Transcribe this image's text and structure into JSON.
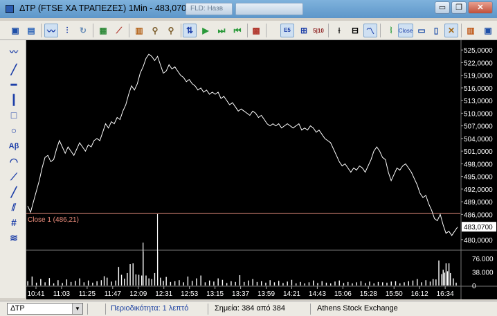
{
  "window": {
    "title": "ΔΤΡ (FTSE ΧΑ ΤΡΑΠΕΖΕΣ) 1Min - 483,0700",
    "field1": "FLD: Назв",
    "field2": "",
    "controls": {
      "minimize": "▭",
      "restore": "❐",
      "close": "✕"
    }
  },
  "toolbar": {
    "icons": [
      "save-icon",
      "properties-icon",
      "line-chart-icon",
      "bar-chart-icon",
      "refresh-icon",
      "grid-chart-icon",
      "indicators-icon",
      "bars-icon",
      "zoom-in-icon",
      "zoom-out-icon",
      "cursor-sync-icon",
      "play-icon",
      "step-forward-icon",
      "step-back-icon",
      "calculator-icon",
      "fibonacci-icon",
      "scale-icon",
      "ohlc-icon",
      "candlestick-icon",
      "line-icon",
      "pattern-icon",
      "close-price-icon",
      "window-icon",
      "layout-icon",
      "tools-icon",
      "export-icon",
      "chart-type-icon"
    ],
    "close_label": "Close",
    "fib_label": "E\n5",
    "scale_label": "5\n10"
  },
  "left_toolbar": {
    "text_tool_label": "Aβ"
  },
  "statusbar": {
    "symbol": "ΔΤΡ",
    "periodicity": "Περιοδικότητα: 1 λεπτό",
    "points": "Σημεία: 384 από 384",
    "exchange": "Athens Stock Exchange"
  },
  "colors": {
    "background": "#000000",
    "price_line": "#ffffff",
    "volume": "#ffffff",
    "reference_line": "#e08a7a",
    "reference_label": "#f08f7e",
    "axis_text": "#ffffff"
  },
  "chart_data": {
    "type": "line",
    "title": "ΔΤΡ (FTSE ΧΑ ΤΡΑΠΕΖΕΣ) 1Min",
    "reference_label": "Close 1 (486,21)",
    "reference_value": 486.21,
    "current_value_label": "483,0700",
    "current_value": 483.07,
    "price_ylim": [
      478.0,
      527.0
    ],
    "price_ticks": [
      "525,0000",
      "522,0000",
      "519,0000",
      "516,0000",
      "513,0000",
      "510,0000",
      "507,0000",
      "504,0000",
      "501,0000",
      "498,0000",
      "495,0000",
      "492,0000",
      "489,0000",
      "486,0000",
      "480,0000"
    ],
    "volume_ticks": [
      "76.000",
      "38.000",
      "0"
    ],
    "volume_ylim": [
      0,
      95000
    ],
    "x_ticks": [
      "10:41",
      "11:03",
      "11:25",
      "11:47",
      "12:09",
      "12:31",
      "12:53",
      "13:15",
      "13:37",
      "13:59",
      "14:21",
      "14:43",
      "15:06",
      "15:28",
      "15:50",
      "16:12",
      "16:34"
    ],
    "price_points": [
      [
        0,
        488.0
      ],
      [
        2,
        486.5
      ],
      [
        4,
        489.0
      ],
      [
        6,
        491.5
      ],
      [
        8,
        494.0
      ],
      [
        10,
        497.0
      ],
      [
        12,
        499.5
      ],
      [
        14,
        500.0
      ],
      [
        16,
        498.5
      ],
      [
        18,
        499.0
      ],
      [
        20,
        501.5
      ],
      [
        22,
        503.5
      ],
      [
        24,
        502.0
      ],
      [
        26,
        500.5
      ],
      [
        28,
        502.0
      ],
      [
        30,
        501.0
      ],
      [
        32,
        500.0
      ],
      [
        34,
        501.5
      ],
      [
        36,
        503.0
      ],
      [
        38,
        502.0
      ],
      [
        40,
        501.0
      ],
      [
        42,
        502.5
      ],
      [
        44,
        502.0
      ],
      [
        46,
        503.5
      ],
      [
        48,
        504.0
      ],
      [
        50,
        503.5
      ],
      [
        52,
        505.5
      ],
      [
        54,
        507.5
      ],
      [
        56,
        506.5
      ],
      [
        58,
        508.0
      ],
      [
        60,
        507.5
      ],
      [
        62,
        509.0
      ],
      [
        64,
        508.5
      ],
      [
        66,
        510.5
      ],
      [
        68,
        512.0
      ],
      [
        70,
        514.5
      ],
      [
        72,
        516.5
      ],
      [
        74,
        515.5
      ],
      [
        76,
        517.0
      ],
      [
        78,
        519.5
      ],
      [
        80,
        521.0
      ],
      [
        82,
        523.0
      ],
      [
        84,
        524.0
      ],
      [
        86,
        523.5
      ],
      [
        88,
        522.5
      ],
      [
        90,
        523.5
      ],
      [
        92,
        521.5
      ],
      [
        94,
        519.5
      ],
      [
        96,
        520.0
      ],
      [
        98,
        521.5
      ],
      [
        100,
        520.5
      ],
      [
        102,
        521.0
      ],
      [
        104,
        520.0
      ],
      [
        106,
        519.0
      ],
      [
        108,
        518.5
      ],
      [
        110,
        517.5
      ],
      [
        112,
        518.0
      ],
      [
        114,
        517.0
      ],
      [
        116,
        516.5
      ],
      [
        118,
        515.5
      ],
      [
        120,
        516.0
      ],
      [
        122,
        515.0
      ],
      [
        124,
        515.5
      ],
      [
        126,
        514.5
      ],
      [
        128,
        515.0
      ],
      [
        130,
        514.5
      ],
      [
        132,
        515.0
      ],
      [
        134,
        513.5
      ],
      [
        136,
        514.0
      ],
      [
        138,
        513.0
      ],
      [
        140,
        512.0
      ],
      [
        142,
        512.5
      ],
      [
        144,
        511.5
      ],
      [
        146,
        510.5
      ],
      [
        148,
        511.0
      ],
      [
        150,
        510.5
      ],
      [
        152,
        510.0
      ],
      [
        154,
        509.5
      ],
      [
        156,
        510.5
      ],
      [
        158,
        510.0
      ],
      [
        160,
        509.0
      ],
      [
        162,
        509.5
      ],
      [
        164,
        508.5
      ],
      [
        166,
        507.5
      ],
      [
        168,
        507.0
      ],
      [
        170,
        507.5
      ],
      [
        172,
        507.0
      ],
      [
        174,
        507.5
      ],
      [
        176,
        506.5
      ],
      [
        178,
        507.0
      ],
      [
        180,
        507.5
      ],
      [
        182,
        507.0
      ],
      [
        184,
        506.5
      ],
      [
        186,
        507.0
      ],
      [
        188,
        507.5
      ],
      [
        190,
        506.0
      ],
      [
        192,
        506.5
      ],
      [
        194,
        506.0
      ],
      [
        196,
        507.0
      ],
      [
        198,
        506.5
      ],
      [
        200,
        505.5
      ],
      [
        202,
        506.0
      ],
      [
        204,
        505.0
      ],
      [
        206,
        504.0
      ],
      [
        208,
        503.5
      ],
      [
        210,
        503.0
      ],
      [
        212,
        501.5
      ],
      [
        214,
        500.0
      ],
      [
        216,
        498.5
      ],
      [
        218,
        497.5
      ],
      [
        220,
        498.0
      ],
      [
        222,
        497.0
      ],
      [
        224,
        496.0
      ],
      [
        226,
        497.0
      ],
      [
        228,
        496.5
      ],
      [
        230,
        497.5
      ],
      [
        232,
        497.0
      ],
      [
        234,
        496.0
      ],
      [
        236,
        497.5
      ],
      [
        238,
        499.0
      ],
      [
        240,
        501.0
      ],
      [
        242,
        502.0
      ],
      [
        244,
        501.0
      ],
      [
        246,
        499.5
      ],
      [
        248,
        499.0
      ],
      [
        250,
        496.0
      ],
      [
        252,
        494.0
      ],
      [
        254,
        495.5
      ],
      [
        256,
        497.0
      ],
      [
        258,
        496.5
      ],
      [
        260,
        497.5
      ],
      [
        262,
        498.0
      ],
      [
        264,
        497.0
      ],
      [
        266,
        496.0
      ],
      [
        268,
        494.5
      ],
      [
        270,
        493.0
      ],
      [
        272,
        491.0
      ],
      [
        274,
        490.0
      ],
      [
        276,
        490.5
      ],
      [
        278,
        488.5
      ],
      [
        280,
        487.0
      ],
      [
        282,
        485.0
      ],
      [
        284,
        484.5
      ],
      [
        286,
        486.0
      ],
      [
        288,
        483.5
      ],
      [
        290,
        481.5
      ],
      [
        292,
        482.0
      ],
      [
        294,
        481.0
      ],
      [
        296,
        482.0
      ],
      [
        298,
        483.0
      ]
    ],
    "volume_points": [
      [
        0,
        12000
      ],
      [
        3,
        25000
      ],
      [
        6,
        8000
      ],
      [
        9,
        18000
      ],
      [
        12,
        9000
      ],
      [
        15,
        21000
      ],
      [
        18,
        6000
      ],
      [
        21,
        15000
      ],
      [
        24,
        7000
      ],
      [
        27,
        17000
      ],
      [
        30,
        10000
      ],
      [
        33,
        13000
      ],
      [
        36,
        20000
      ],
      [
        39,
        9000
      ],
      [
        42,
        14000
      ],
      [
        45,
        8000
      ],
      [
        48,
        12000
      ],
      [
        51,
        15000
      ],
      [
        53,
        26000
      ],
      [
        55,
        22000
      ],
      [
        58,
        11000
      ],
      [
        61,
        14000
      ],
      [
        63,
        52000
      ],
      [
        65,
        30000
      ],
      [
        67,
        19000
      ],
      [
        69,
        35000
      ],
      [
        71,
        60000
      ],
      [
        73,
        62000
      ],
      [
        75,
        31000
      ],
      [
        77,
        30000
      ],
      [
        79,
        28000
      ],
      [
        80,
        120000
      ],
      [
        82,
        28000
      ],
      [
        84,
        20000
      ],
      [
        86,
        18000
      ],
      [
        88,
        35000
      ],
      [
        90,
        200000
      ],
      [
        92,
        22000
      ],
      [
        94,
        13000
      ],
      [
        96,
        24000
      ],
      [
        99,
        10000
      ],
      [
        102,
        12000
      ],
      [
        105,
        15000
      ],
      [
        108,
        9000
      ],
      [
        111,
        25000
      ],
      [
        114,
        13000
      ],
      [
        117,
        20000
      ],
      [
        120,
        28000
      ],
      [
        123,
        9000
      ],
      [
        126,
        14000
      ],
      [
        129,
        11000
      ],
      [
        132,
        20000
      ],
      [
        135,
        16000
      ],
      [
        138,
        7000
      ],
      [
        141,
        12000
      ],
      [
        144,
        10000
      ],
      [
        147,
        29000
      ],
      [
        150,
        10000
      ],
      [
        153,
        14000
      ],
      [
        156,
        18000
      ],
      [
        159,
        10000
      ],
      [
        162,
        12000
      ],
      [
        165,
        8000
      ],
      [
        168,
        15000
      ],
      [
        171,
        9000
      ],
      [
        174,
        13000
      ],
      [
        177,
        7000
      ],
      [
        180,
        11000
      ],
      [
        183,
        16000
      ],
      [
        186,
        6000
      ],
      [
        189,
        10000
      ],
      [
        192,
        6000
      ],
      [
        195,
        9000
      ],
      [
        198,
        14000
      ],
      [
        201,
        7000
      ],
      [
        204,
        12000
      ],
      [
        207,
        8000
      ],
      [
        210,
        6000
      ],
      [
        213,
        11000
      ],
      [
        216,
        14000
      ],
      [
        219,
        7000
      ],
      [
        222,
        10000
      ],
      [
        225,
        6000
      ],
      [
        228,
        9000
      ],
      [
        231,
        12000
      ],
      [
        234,
        7000
      ],
      [
        237,
        11000
      ],
      [
        240,
        6000
      ],
      [
        243,
        10000
      ],
      [
        246,
        9000
      ],
      [
        249,
        8000
      ],
      [
        252,
        11000
      ],
      [
        255,
        12000
      ],
      [
        258,
        6000
      ],
      [
        261,
        9000
      ],
      [
        264,
        12000
      ],
      [
        267,
        14000
      ],
      [
        270,
        18000
      ],
      [
        273,
        9000
      ],
      [
        276,
        15000
      ],
      [
        279,
        11000
      ],
      [
        281,
        18000
      ],
      [
        283,
        17000
      ],
      [
        285,
        70000
      ],
      [
        287,
        32000
      ],
      [
        288,
        44000
      ],
      [
        289,
        36000
      ],
      [
        290,
        62000
      ],
      [
        291,
        40000
      ],
      [
        292,
        62000
      ],
      [
        293,
        35000
      ],
      [
        295,
        20000
      ],
      [
        297,
        8000
      ]
    ]
  }
}
